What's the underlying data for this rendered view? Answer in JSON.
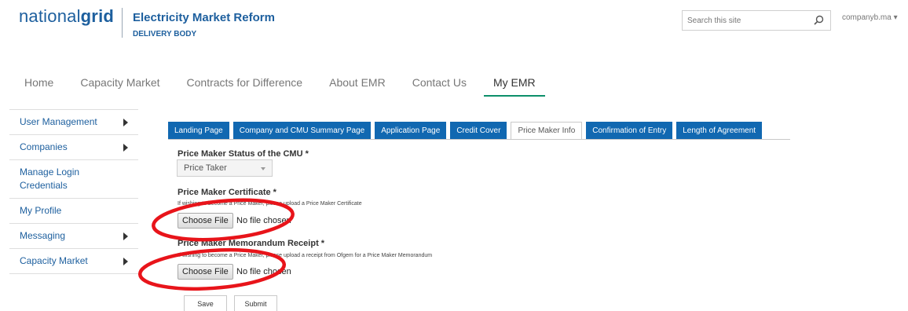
{
  "header": {
    "logo_light": "national",
    "logo_bold": "grid",
    "title": "Electricity Market Reform",
    "subtitle": "DELIVERY BODY",
    "search_placeholder": "Search this site",
    "user": "companyb.ma ▾"
  },
  "nav": [
    "Home",
    "Capacity Market",
    "Contracts for Difference",
    "About EMR",
    "Contact Us",
    "My EMR"
  ],
  "nav_active": "My EMR",
  "sidebar": [
    {
      "label": "User Management"
    },
    {
      "label": "Companies"
    },
    {
      "label": "Manage Login Credentials"
    },
    {
      "label": "My Profile"
    },
    {
      "label": "Messaging"
    },
    {
      "label": "Capacity Market"
    }
  ],
  "tabs": [
    "Landing Page",
    "Company and CMU Summary Page",
    "Application Page",
    "Credit Cover",
    "Price Maker Info",
    "Confirmation of Entry",
    "Length of Agreement"
  ],
  "active_tab": "Price Maker Info",
  "form": {
    "status_label": "Price Maker Status of the CMU *",
    "status_value": "Price Taker",
    "cert_label": "Price Maker Certificate *",
    "cert_note": "If wishing to become a Price Maker, please upload a Price Maker Certificate",
    "memo_label": "Price Maker Memorandum Receipt *",
    "memo_note": "If wishing to become a Price Maker, please upload a receipt from Ofgem for a Price Maker Memorandum",
    "choose_file": "Choose File",
    "no_file": "No file chosen",
    "save": "Save",
    "submit": "Submit"
  },
  "colors": {
    "brand_blue": "#1d5f9e",
    "tab_blue": "#1168b1",
    "nav_active_underline": "#0d8f6a",
    "annotation_red": "#e8141a"
  }
}
